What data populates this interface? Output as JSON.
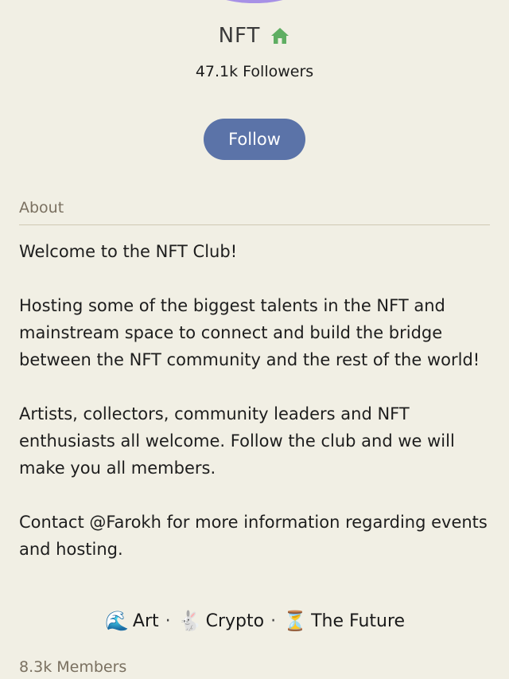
{
  "club": {
    "name": "NFT",
    "followers": "47.1k Followers",
    "follow_label": "Follow"
  },
  "about": {
    "label": "About",
    "paragraphs": [
      "Welcome to the NFT Club!",
      "Hosting some of the biggest talents in the NFT and mainstream space to connect and build the bridge between the NFT community and the rest of the world!",
      "Artists, collectors, community leaders and NFT enthusiasts all welcome. Follow the club and we will make you all members.",
      "Contact @Farokh for more information regarding events and hosting."
    ]
  },
  "tags": [
    {
      "icon": "wave-icon",
      "glyph": "🌊",
      "label": "Art"
    },
    {
      "icon": "rabbit-icon",
      "glyph": "🐇",
      "label": "Crypto"
    },
    {
      "icon": "hourglass-icon",
      "glyph": "⏳",
      "label": "The Future"
    }
  ],
  "members": "8.3k Members",
  "colors": {
    "background": "#f1efe4",
    "follow_button": "#5b73a8",
    "home_icon": "#5fae62",
    "muted_text": "#7a7060",
    "avatar": "#a791e6"
  }
}
